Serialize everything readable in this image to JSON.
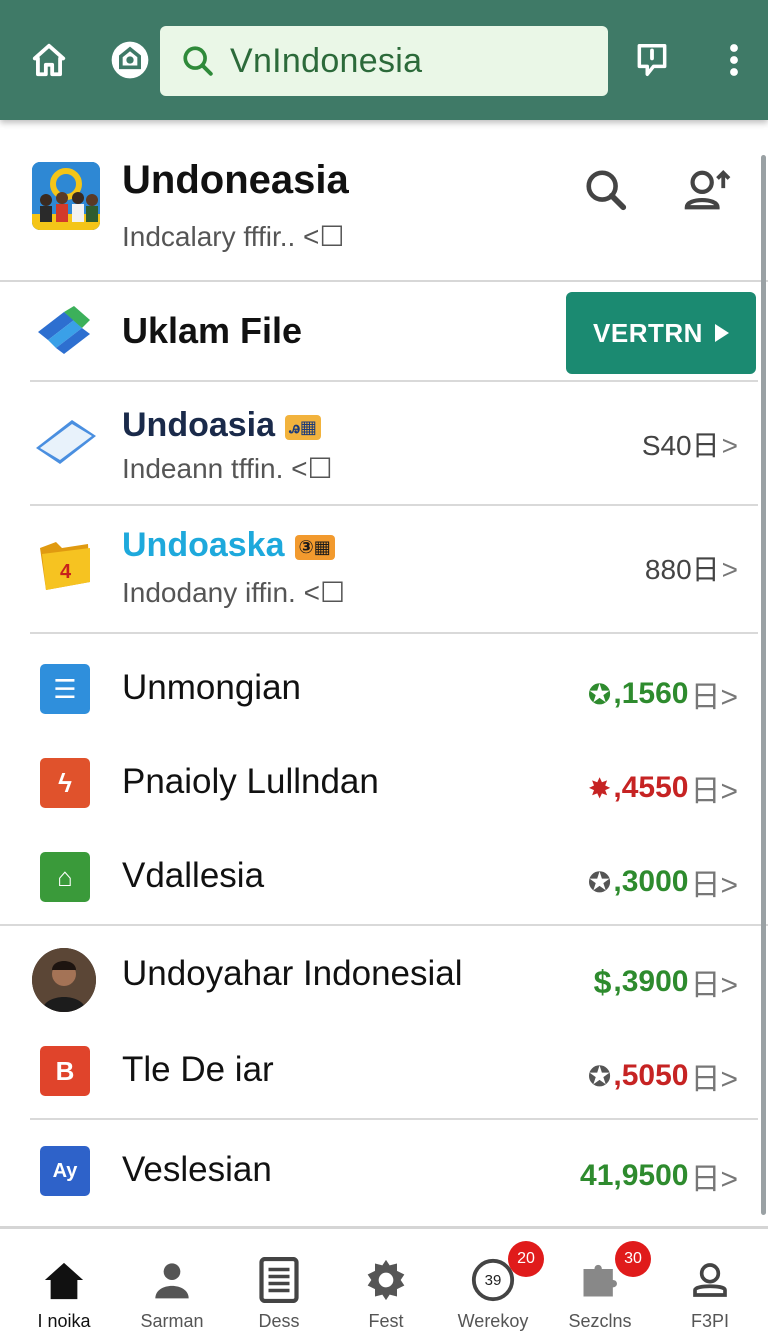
{
  "search": {
    "value": "VnIndonesia"
  },
  "header": {
    "title": "Undoneasia",
    "subtitle": "Indcalary fffir.. <",
    "subtitle_box": "☐"
  },
  "file_row": {
    "label": "Uklam File",
    "button_label": "VERTRN"
  },
  "items_two_line": [
    {
      "title": "Undoasia",
      "badge": "ꭿ▦",
      "subtitle": "Indeann tffin. <",
      "box": "☐",
      "value": "S40日",
      "chevron": ">",
      "title_color": "#1a2a4a"
    },
    {
      "title": "Undoaska",
      "badge": "③▦",
      "subtitle": "Indodany iffin. <",
      "box": "☐",
      "value": "880日",
      "chevron": ">",
      "title_color": "#1ea9dc"
    }
  ],
  "items_one_line": [
    {
      "title": "Unmongian",
      "prefix": "✪",
      "value": ",1560",
      "tail": "日>",
      "value_color": "#2e8b2e",
      "icon_color": "#2f8fdc",
      "icon_glyph": "☰"
    },
    {
      "title": "Pnaioly Lullndan",
      "prefix": "✸",
      "value": ",4550",
      "tail": "日>",
      "value_color": "#c62323",
      "icon_color": "#e0522c",
      "icon_glyph": "ϟ"
    },
    {
      "title": "Vdallesia",
      "prefix": "✪",
      "value": ",3000",
      "tail": "日>",
      "value_color": "#2e8b2e",
      "icon_color": "#3a9a3a",
      "icon_glyph": "⌂"
    },
    {
      "title": "Undoyahar Indonesial",
      "prefix": "$",
      "value": ",3900",
      "tail": "日>",
      "value_color": "#2e8b2e",
      "icon_color": "",
      "icon_glyph": ""
    },
    {
      "title": "Tle De iar",
      "prefix": "✪",
      "value": ",5050",
      "tail": "日>",
      "value_color": "#c62323",
      "icon_color": "#e0442b",
      "icon_glyph": "B"
    },
    {
      "title": "Veslesian",
      "prefix": "",
      "value": "41,9500",
      "tail": "日>",
      "value_color": "#2e8b2e",
      "icon_color": "#2e62c9",
      "icon_glyph": "Ay"
    }
  ],
  "bottom_nav": [
    {
      "label": "I noika",
      "icon": "home-icon",
      "badge": ""
    },
    {
      "label": "Sarman",
      "icon": "person-icon",
      "badge": ""
    },
    {
      "label": "Dess",
      "icon": "document-icon",
      "badge": ""
    },
    {
      "label": "Fest",
      "icon": "gear-icon",
      "badge": ""
    },
    {
      "label": "Werekoy",
      "icon": "speed-icon",
      "badge": "20",
      "icon_text": "39"
    },
    {
      "label": "Sezclns",
      "icon": "puzzle-icon",
      "badge": "30"
    },
    {
      "label": "F3PI",
      "icon": "account-icon",
      "badge": ""
    }
  ],
  "colors": {
    "topbar": "#3f7a67",
    "accent_button": "#1b8a71",
    "badge_red": "#e01b1b"
  }
}
